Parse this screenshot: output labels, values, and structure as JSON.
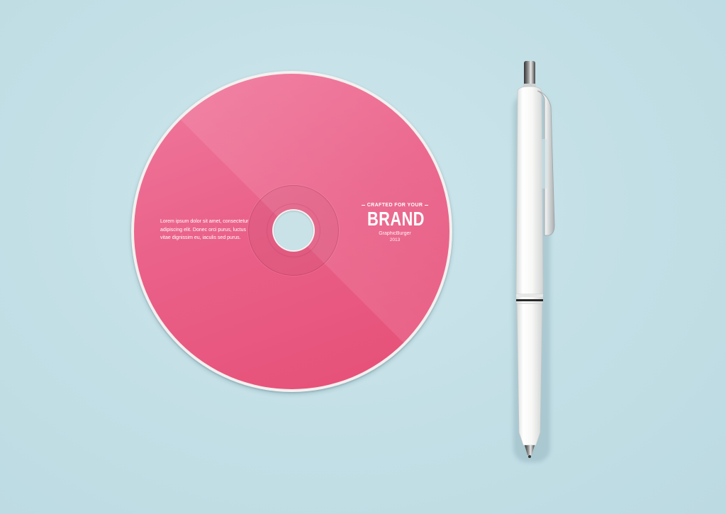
{
  "cd": {
    "body_text": "Lorem ipsum dolor sit amet, consectetur adipiscing elit. Donec orci purus, luctus vitae dignissim eu, iaculis sed purus.",
    "tagline": "CRAFTED FOR YOUR",
    "brand": "BRAND",
    "subtitle": "GraphicBurger",
    "year": "2013"
  },
  "colors": {
    "background": "#c5e1e8",
    "cd_pink": "#e95b84",
    "cd_rim": "#f4f0ef",
    "pen_body": "#f5f5f3"
  },
  "icons": {
    "pen": "ballpoint-pen-icon",
    "cd": "compact-disc-icon"
  }
}
